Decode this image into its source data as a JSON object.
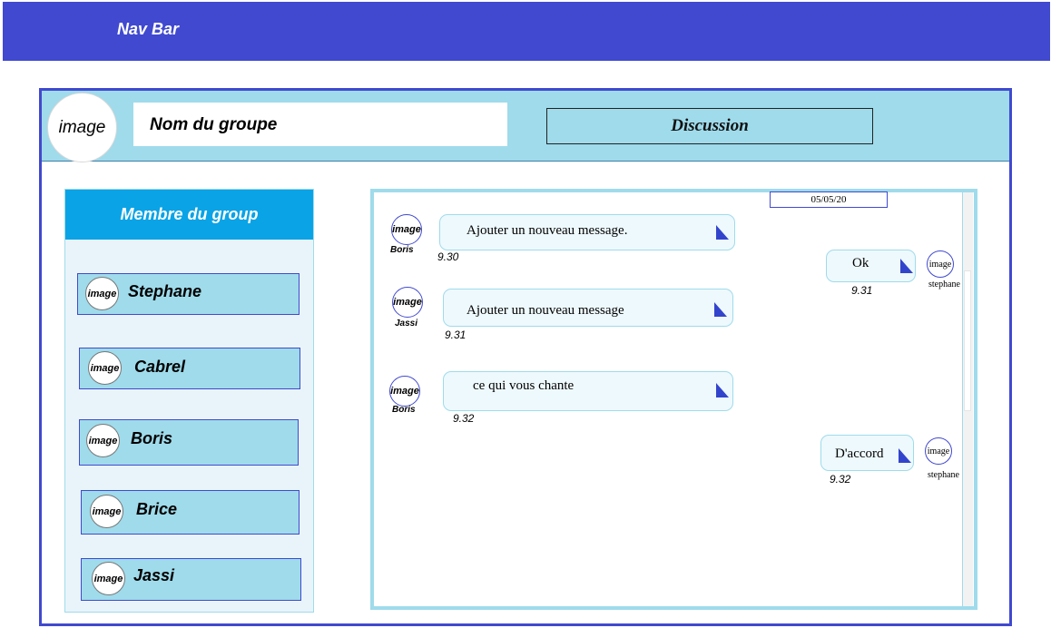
{
  "navbar": {
    "title": "Nav Bar"
  },
  "header": {
    "group_avatar": "image",
    "group_name": "Nom du groupe",
    "discussion_label": "Discussion"
  },
  "members": {
    "title": "Membre du group",
    "items": [
      {
        "avatar": "image",
        "name": "Stephane"
      },
      {
        "avatar": "image",
        "name": "Cabrel"
      },
      {
        "avatar": "image",
        "name": "Boris"
      },
      {
        "avatar": "image",
        "name": "Brice"
      },
      {
        "avatar": "image",
        "name": "Jassi"
      }
    ]
  },
  "chat": {
    "date": "05/05/20",
    "messages": [
      {
        "side": "left",
        "avatar": "image",
        "sender": "Boris",
        "text": "Ajouter un nouveau message.",
        "time": "9.30"
      },
      {
        "side": "right",
        "avatar": "image",
        "sender": "stephane",
        "text": "Ok",
        "time": "9.31"
      },
      {
        "side": "left",
        "avatar": "image",
        "sender": "Jassi",
        "text": "Ajouter un nouveau message",
        "time": "9.31"
      },
      {
        "side": "left",
        "avatar": "image",
        "sender": "Boris",
        "text": "ce qui vous chante",
        "time": "9.32"
      },
      {
        "side": "right",
        "avatar": "image",
        "sender": "stephane",
        "text": "D'accord",
        "time": "9.32"
      }
    ]
  },
  "colors": {
    "nav": "#4049cf",
    "header_bg": "#9fdbeb",
    "members_header": "#0aa3e6",
    "bubble": "#eef9fd",
    "send_icon": "#3344cc"
  },
  "icons": {
    "send": "send-corner-icon"
  }
}
